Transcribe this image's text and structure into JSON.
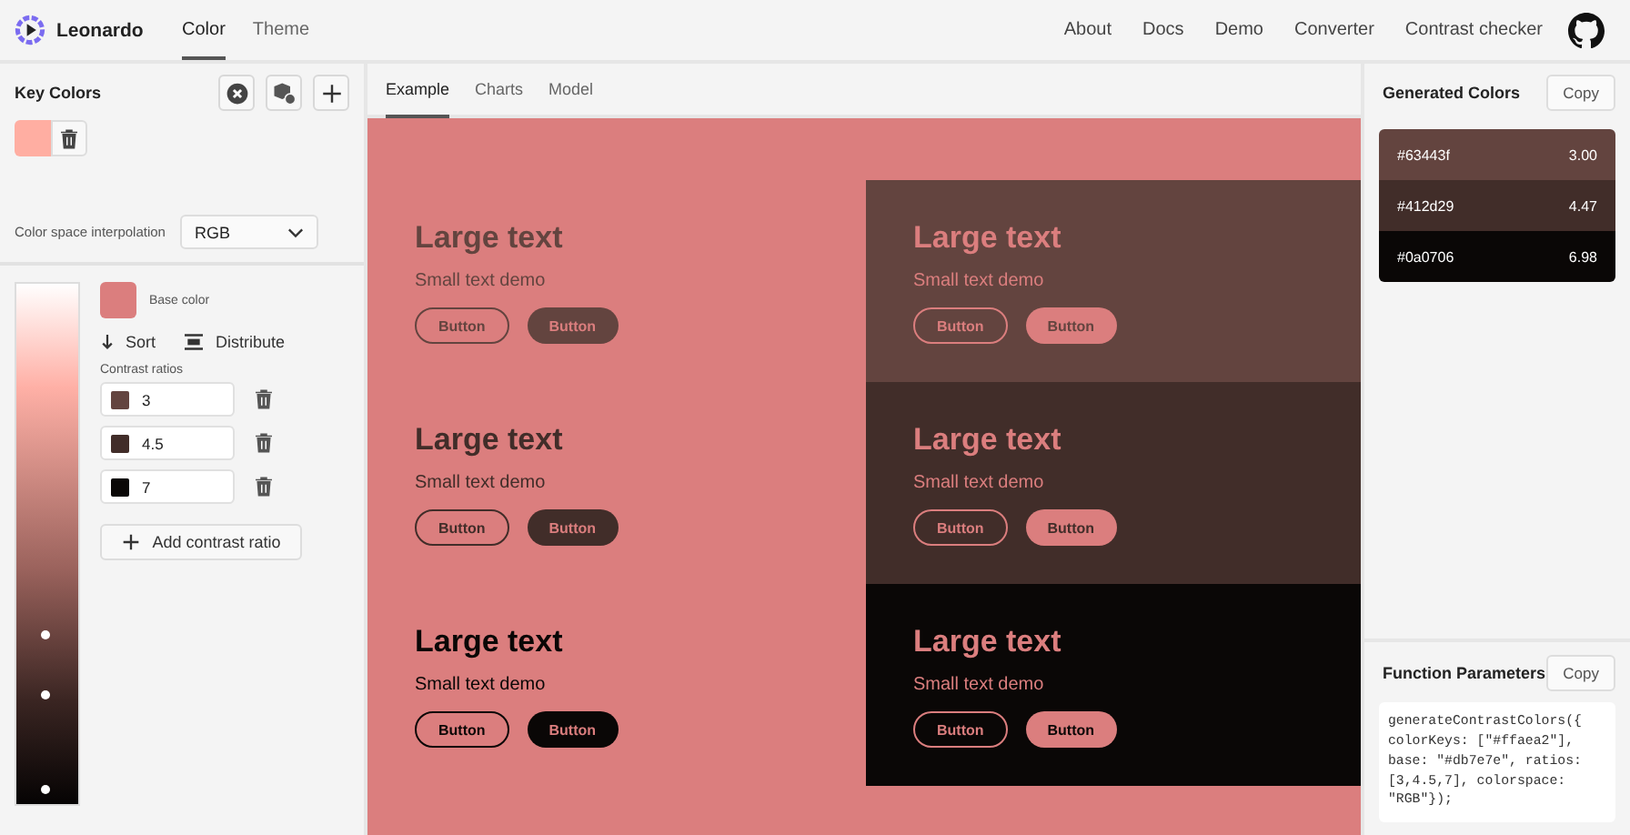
{
  "header": {
    "app_name": "Leonardo",
    "tabs": [
      {
        "label": "Color",
        "selected": true
      },
      {
        "label": "Theme",
        "selected": false
      }
    ],
    "links": [
      "About",
      "Docs",
      "Demo",
      "Converter",
      "Contrast checker"
    ]
  },
  "key_colors": {
    "title": "Key Colors",
    "swatches": [
      {
        "color": "#ffaea2"
      }
    ]
  },
  "interpolation": {
    "label": "Color space interpolation",
    "value": "RGB"
  },
  "scale": {
    "base_label": "Base color",
    "sort": "Sort",
    "distribute": "Distribute",
    "ratios_label": "Contrast ratios",
    "ratios": [
      {
        "value": "3",
        "color": "#63443f"
      },
      {
        "value": "4.5",
        "color": "#412d29"
      },
      {
        "value": "7",
        "color": "#0a0706"
      }
    ],
    "add_label": "Add contrast ratio"
  },
  "view_tabs": [
    {
      "label": "Example",
      "selected": true
    },
    {
      "label": "Charts",
      "selected": false
    },
    {
      "label": "Model",
      "selected": false
    }
  ],
  "demo_rows": [
    {
      "color": "#63443f",
      "large": "Large text",
      "small": "Small text demo",
      "outline_button": "Button",
      "filled_button": "Button",
      "panel_large": "Large text",
      "panel_small": "Small text demo",
      "panel_outline_button": "Button",
      "panel_filled_button": "Button"
    },
    {
      "color": "#412d29",
      "large": "Large text",
      "small": "Small text demo",
      "outline_button": "Button",
      "filled_button": "Button",
      "panel_large": "Large text",
      "panel_small": "Small text demo",
      "panel_outline_button": "Button",
      "panel_filled_button": "Button"
    },
    {
      "color": "#0a0706",
      "large": "Large text",
      "small": "Small text demo",
      "outline_button": "Button",
      "filled_button": "Button",
      "panel_large": "Large text",
      "panel_small": "Small text demo",
      "panel_outline_button": "Button",
      "panel_filled_button": "Button"
    }
  ],
  "generated": {
    "title": "Generated Colors",
    "copy": "Copy",
    "colors": [
      {
        "hex": "#63443f",
        "ratio": "3.00",
        "color": "#63443f"
      },
      {
        "hex": "#412d29",
        "ratio": "4.47",
        "color": "#412d29"
      },
      {
        "hex": "#0a0706",
        "ratio": "6.98",
        "color": "#0a0706"
      }
    ]
  },
  "function_params": {
    "title": "Function Parameters",
    "copy": "Copy",
    "code": "generateContrastColors({\ncolorKeys: [\"#ffaea2\"],\nbase: \"#db7e7e\", ratios:\n[3,4.5,7], colorspace:\n\"RGB\"});"
  }
}
